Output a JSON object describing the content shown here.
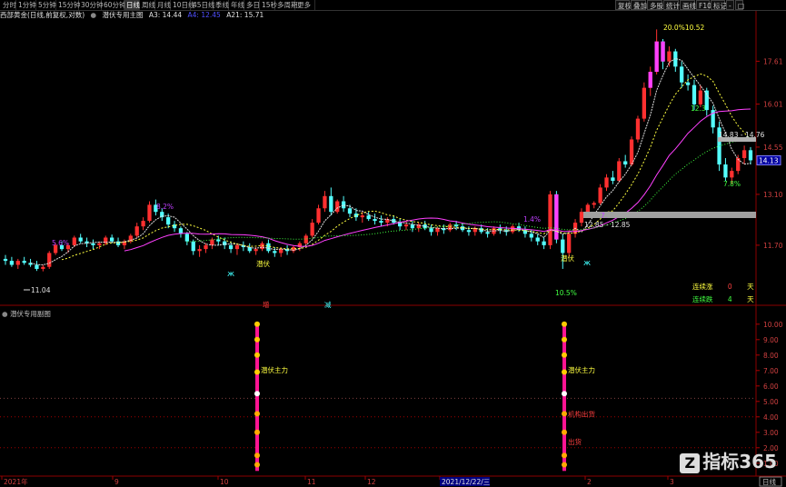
{
  "toolbar": {
    "tabs": [
      "分时",
      "1分钟",
      "5分钟",
      "15分钟",
      "30分钟",
      "60分钟",
      "日线",
      "周线",
      "月线",
      "10日线",
      "45日线",
      "季线",
      "年线",
      "多日",
      "15秒",
      "多周期",
      "更多"
    ],
    "selected_index": 6,
    "right_tabs": [
      "复权",
      "叠加",
      "多股",
      "统计",
      "画线",
      "F10",
      "标记",
      "-",
      "□"
    ]
  },
  "infobar": {
    "title": "西部黄金(日线,前复权,对数)",
    "main_formula": "潜伏专用主图",
    "a3": "A3: 14.44",
    "a4": "A4: 12.45",
    "a21": "A21: 15.71",
    "a4_color": "#5050ff",
    "a21_color": "#e0e0e0"
  },
  "price_axis": {
    "labels": [
      "17.61",
      "16.01",
      "14.55",
      "13.10",
      "11.70"
    ],
    "current_price": "14.13"
  },
  "annotations": {
    "peak": "20.0%10.52",
    "low": "11.04",
    "p1": "8.2%",
    "p2": "5.6%",
    "p3": "1.4%",
    "p4": "7.",
    "p5": "12.3",
    "p6": "7.8%",
    "p7": "10.5%",
    "box1": "14.83 - 14.76",
    "box2": "12.85 - 12.85",
    "mark_a": "增",
    "mark_b": "减",
    "signal_a": "潜伏",
    "signal_b": "潜伏"
  },
  "counter": {
    "up_label": "连续涨",
    "up_value": "0",
    "up_unit": "天",
    "down_label": "连续跌",
    "down_value": "4",
    "down_unit": "天"
  },
  "indicator": {
    "title": "潜伏专用副图",
    "axis": [
      "10.00",
      "9.00",
      "8.00",
      "7.00",
      "6.00",
      "5.00",
      "4.00",
      "3.00",
      "2.00",
      "1.00"
    ],
    "label1": "潜伏主力",
    "label2": "潜伏主力",
    "label3": "机构出货",
    "label4": "出货"
  },
  "date_axis": {
    "labels": [
      "2021年",
      "9",
      "10",
      "11",
      "12",
      "2021/12/22/三",
      "2",
      "3"
    ],
    "right_box": "日线"
  },
  "watermark": "指标365",
  "chart_data": {
    "type": "candlestick",
    "title": "西部黄金(日线,前复权,对数)",
    "ylim": [
      10.3,
      19.3
    ],
    "yscale": "log",
    "up_color": "#ff3030",
    "down_color": "#54ffff",
    "ohlc": [
      [
        11.35,
        11.45,
        11.2,
        11.3
      ],
      [
        11.3,
        11.4,
        11.15,
        11.2
      ],
      [
        11.2,
        11.35,
        11.1,
        11.3
      ],
      [
        11.3,
        11.4,
        11.2,
        11.25
      ],
      [
        11.25,
        11.35,
        11.15,
        11.2
      ],
      [
        11.2,
        11.3,
        11.05,
        11.1
      ],
      [
        11.1,
        11.2,
        11.04,
        11.15
      ],
      [
        11.15,
        11.55,
        11.1,
        11.5
      ],
      [
        11.5,
        11.75,
        11.45,
        11.7
      ],
      [
        11.7,
        11.8,
        11.55,
        11.6
      ],
      [
        11.6,
        11.75,
        11.5,
        11.7
      ],
      [
        11.7,
        11.95,
        11.65,
        11.9
      ],
      [
        11.9,
        12.0,
        11.75,
        11.8
      ],
      [
        11.8,
        11.9,
        11.65,
        11.75
      ],
      [
        11.75,
        11.85,
        11.6,
        11.7
      ],
      [
        11.7,
        11.8,
        11.6,
        11.75
      ],
      [
        11.75,
        11.95,
        11.7,
        11.9
      ],
      [
        11.9,
        11.98,
        11.75,
        11.8
      ],
      [
        11.8,
        11.9,
        11.65,
        11.7
      ],
      [
        11.7,
        11.85,
        11.6,
        11.8
      ],
      [
        11.8,
        12.0,
        11.75,
        11.95
      ],
      [
        11.95,
        12.3,
        11.9,
        12.2
      ],
      [
        12.2,
        12.45,
        12.1,
        12.35
      ],
      [
        12.35,
        12.9,
        12.3,
        12.8
      ],
      [
        12.8,
        12.95,
        12.5,
        12.6
      ],
      [
        12.6,
        12.7,
        12.35,
        12.45
      ],
      [
        12.45,
        12.55,
        12.15,
        12.25
      ],
      [
        12.25,
        12.35,
        12.05,
        12.15
      ],
      [
        12.15,
        12.2,
        11.9,
        12.0
      ],
      [
        12.0,
        12.05,
        11.7,
        11.8
      ],
      [
        11.8,
        11.85,
        11.45,
        11.55
      ],
      [
        11.55,
        11.7,
        11.4,
        11.6
      ],
      [
        11.6,
        11.75,
        11.5,
        11.7
      ],
      [
        11.7,
        11.9,
        11.6,
        11.85
      ],
      [
        11.85,
        11.95,
        11.7,
        11.8
      ],
      [
        11.8,
        11.9,
        11.6,
        11.7
      ],
      [
        11.7,
        11.8,
        11.5,
        11.6
      ],
      [
        11.6,
        11.75,
        11.45,
        11.7
      ],
      [
        11.7,
        11.8,
        11.55,
        11.65
      ],
      [
        11.65,
        11.75,
        11.5,
        11.55
      ],
      [
        11.55,
        11.65,
        11.45,
        11.6
      ],
      [
        11.6,
        11.8,
        11.55,
        11.75
      ],
      [
        11.75,
        11.85,
        11.5,
        11.55
      ],
      [
        11.55,
        11.65,
        11.4,
        11.5
      ],
      [
        11.5,
        11.65,
        11.4,
        11.6
      ],
      [
        11.6,
        11.7,
        11.45,
        11.55
      ],
      [
        11.55,
        11.7,
        11.5,
        11.65
      ],
      [
        11.65,
        11.8,
        11.55,
        11.75
      ],
      [
        11.75,
        12.0,
        11.7,
        11.95
      ],
      [
        11.95,
        12.4,
        11.9,
        12.3
      ],
      [
        12.3,
        12.8,
        12.25,
        12.7
      ],
      [
        12.7,
        13.2,
        12.6,
        13.05
      ],
      [
        13.05,
        13.3,
        12.5,
        12.6
      ],
      [
        12.6,
        12.95,
        12.55,
        12.9
      ],
      [
        12.9,
        13.05,
        12.6,
        12.7
      ],
      [
        12.7,
        12.8,
        12.45,
        12.55
      ],
      [
        12.55,
        12.7,
        12.35,
        12.45
      ],
      [
        12.45,
        12.6,
        12.3,
        12.5
      ],
      [
        12.5,
        12.6,
        12.35,
        12.4
      ],
      [
        12.4,
        12.55,
        12.25,
        12.35
      ],
      [
        12.35,
        12.5,
        12.2,
        12.3
      ],
      [
        12.3,
        12.45,
        12.2,
        12.4
      ],
      [
        12.4,
        12.5,
        12.25,
        12.3
      ],
      [
        12.3,
        12.4,
        12.1,
        12.2
      ],
      [
        12.2,
        12.35,
        12.1,
        12.25
      ],
      [
        12.25,
        12.35,
        12.05,
        12.15
      ],
      [
        12.15,
        12.3,
        12.05,
        12.25
      ],
      [
        12.25,
        12.35,
        12.1,
        12.15
      ],
      [
        12.15,
        12.25,
        11.95,
        12.05
      ],
      [
        12.05,
        12.2,
        11.95,
        12.15
      ],
      [
        12.15,
        12.25,
        12.0,
        12.1
      ],
      [
        12.1,
        12.3,
        12.05,
        12.25
      ],
      [
        12.25,
        12.35,
        12.1,
        12.2
      ],
      [
        12.2,
        12.3,
        12.05,
        12.1
      ],
      [
        12.1,
        12.2,
        11.95,
        12.05
      ],
      [
        12.05,
        12.2,
        11.95,
        12.15
      ],
      [
        12.15,
        12.25,
        12.0,
        12.05
      ],
      [
        12.05,
        12.15,
        11.9,
        12.0
      ],
      [
        12.0,
        12.2,
        11.95,
        12.15
      ],
      [
        12.15,
        12.25,
        12.0,
        12.1
      ],
      [
        12.1,
        12.2,
        11.95,
        12.05
      ],
      [
        12.05,
        12.25,
        12.0,
        12.2
      ],
      [
        12.2,
        12.3,
        12.05,
        12.1
      ],
      [
        12.1,
        12.2,
        11.9,
        12.0
      ],
      [
        12.0,
        12.1,
        11.8,
        11.9
      ],
      [
        11.9,
        12.0,
        11.7,
        11.8
      ],
      [
        11.8,
        11.9,
        11.6,
        11.7
      ],
      [
        11.7,
        13.2,
        11.6,
        13.1
      ],
      [
        13.1,
        13.2,
        11.75,
        11.85
      ],
      [
        11.85,
        12.0,
        11.1,
        11.5
      ],
      [
        11.5,
        12.1,
        11.4,
        12.0
      ],
      [
        12.0,
        12.4,
        11.9,
        12.3
      ],
      [
        12.3,
        12.7,
        12.2,
        12.6
      ],
      [
        12.6,
        12.85,
        12.5,
        12.8
      ],
      [
        12.8,
        12.9,
        12.7,
        12.85
      ],
      [
        12.85,
        13.4,
        12.8,
        13.3
      ],
      [
        13.3,
        13.7,
        13.2,
        13.6
      ],
      [
        13.6,
        13.8,
        13.4,
        13.5
      ],
      [
        13.5,
        14.2,
        13.45,
        14.1
      ],
      [
        14.1,
        14.3,
        13.9,
        14.0
      ],
      [
        14.0,
        14.9,
        13.95,
        14.8
      ],
      [
        14.8,
        15.6,
        14.7,
        15.5
      ],
      [
        15.5,
        16.8,
        15.4,
        16.6
      ],
      [
        16.6,
        17.4,
        16.3,
        17.2
      ],
      [
        17.2,
        18.9,
        17.1,
        18.4
      ],
      [
        18.4,
        18.5,
        17.3,
        17.6
      ],
      [
        17.6,
        18.2,
        17.4,
        18.0
      ],
      [
        18.0,
        18.1,
        17.2,
        17.4
      ],
      [
        17.4,
        17.6,
        16.6,
        16.8
      ],
      [
        16.8,
        17.1,
        16.5,
        16.7
      ],
      [
        16.7,
        16.9,
        15.8,
        16.0
      ],
      [
        16.0,
        16.7,
        15.9,
        16.5
      ],
      [
        16.5,
        16.6,
        15.6,
        15.8
      ],
      [
        15.8,
        15.95,
        15.0,
        15.2
      ],
      [
        15.2,
        15.4,
        13.8,
        14.0
      ],
      [
        14.0,
        14.2,
        13.5,
        13.6
      ],
      [
        13.6,
        13.9,
        13.4,
        13.8
      ],
      [
        13.8,
        14.3,
        13.7,
        14.2
      ],
      [
        14.2,
        14.6,
        14.0,
        14.45
      ],
      [
        14.45,
        14.55,
        14.0,
        14.13
      ]
    ]
  }
}
